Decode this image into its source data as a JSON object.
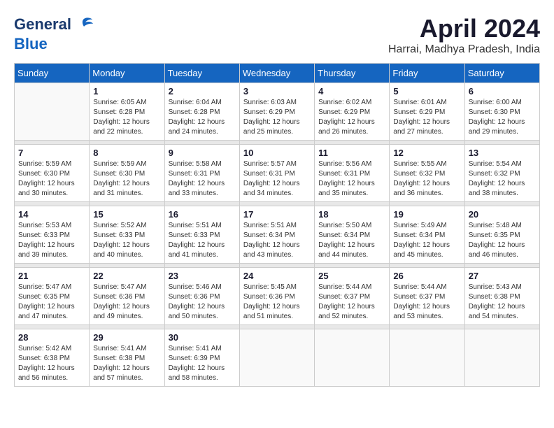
{
  "header": {
    "logo_line1": "General",
    "logo_line2": "Blue",
    "title": "April 2024",
    "subtitle": "Harrai, Madhya Pradesh, India"
  },
  "days_of_week": [
    "Sunday",
    "Monday",
    "Tuesday",
    "Wednesday",
    "Thursday",
    "Friday",
    "Saturday"
  ],
  "weeks": [
    [
      {
        "day": "",
        "info": ""
      },
      {
        "day": "1",
        "info": "Sunrise: 6:05 AM\nSunset: 6:28 PM\nDaylight: 12 hours\nand 22 minutes."
      },
      {
        "day": "2",
        "info": "Sunrise: 6:04 AM\nSunset: 6:28 PM\nDaylight: 12 hours\nand 24 minutes."
      },
      {
        "day": "3",
        "info": "Sunrise: 6:03 AM\nSunset: 6:29 PM\nDaylight: 12 hours\nand 25 minutes."
      },
      {
        "day": "4",
        "info": "Sunrise: 6:02 AM\nSunset: 6:29 PM\nDaylight: 12 hours\nand 26 minutes."
      },
      {
        "day": "5",
        "info": "Sunrise: 6:01 AM\nSunset: 6:29 PM\nDaylight: 12 hours\nand 27 minutes."
      },
      {
        "day": "6",
        "info": "Sunrise: 6:00 AM\nSunset: 6:30 PM\nDaylight: 12 hours\nand 29 minutes."
      }
    ],
    [
      {
        "day": "7",
        "info": "Sunrise: 5:59 AM\nSunset: 6:30 PM\nDaylight: 12 hours\nand 30 minutes."
      },
      {
        "day": "8",
        "info": "Sunrise: 5:59 AM\nSunset: 6:30 PM\nDaylight: 12 hours\nand 31 minutes."
      },
      {
        "day": "9",
        "info": "Sunrise: 5:58 AM\nSunset: 6:31 PM\nDaylight: 12 hours\nand 33 minutes."
      },
      {
        "day": "10",
        "info": "Sunrise: 5:57 AM\nSunset: 6:31 PM\nDaylight: 12 hours\nand 34 minutes."
      },
      {
        "day": "11",
        "info": "Sunrise: 5:56 AM\nSunset: 6:31 PM\nDaylight: 12 hours\nand 35 minutes."
      },
      {
        "day": "12",
        "info": "Sunrise: 5:55 AM\nSunset: 6:32 PM\nDaylight: 12 hours\nand 36 minutes."
      },
      {
        "day": "13",
        "info": "Sunrise: 5:54 AM\nSunset: 6:32 PM\nDaylight: 12 hours\nand 38 minutes."
      }
    ],
    [
      {
        "day": "14",
        "info": "Sunrise: 5:53 AM\nSunset: 6:33 PM\nDaylight: 12 hours\nand 39 minutes."
      },
      {
        "day": "15",
        "info": "Sunrise: 5:52 AM\nSunset: 6:33 PM\nDaylight: 12 hours\nand 40 minutes."
      },
      {
        "day": "16",
        "info": "Sunrise: 5:51 AM\nSunset: 6:33 PM\nDaylight: 12 hours\nand 41 minutes."
      },
      {
        "day": "17",
        "info": "Sunrise: 5:51 AM\nSunset: 6:34 PM\nDaylight: 12 hours\nand 43 minutes."
      },
      {
        "day": "18",
        "info": "Sunrise: 5:50 AM\nSunset: 6:34 PM\nDaylight: 12 hours\nand 44 minutes."
      },
      {
        "day": "19",
        "info": "Sunrise: 5:49 AM\nSunset: 6:34 PM\nDaylight: 12 hours\nand 45 minutes."
      },
      {
        "day": "20",
        "info": "Sunrise: 5:48 AM\nSunset: 6:35 PM\nDaylight: 12 hours\nand 46 minutes."
      }
    ],
    [
      {
        "day": "21",
        "info": "Sunrise: 5:47 AM\nSunset: 6:35 PM\nDaylight: 12 hours\nand 47 minutes."
      },
      {
        "day": "22",
        "info": "Sunrise: 5:47 AM\nSunset: 6:36 PM\nDaylight: 12 hours\nand 49 minutes."
      },
      {
        "day": "23",
        "info": "Sunrise: 5:46 AM\nSunset: 6:36 PM\nDaylight: 12 hours\nand 50 minutes."
      },
      {
        "day": "24",
        "info": "Sunrise: 5:45 AM\nSunset: 6:36 PM\nDaylight: 12 hours\nand 51 minutes."
      },
      {
        "day": "25",
        "info": "Sunrise: 5:44 AM\nSunset: 6:37 PM\nDaylight: 12 hours\nand 52 minutes."
      },
      {
        "day": "26",
        "info": "Sunrise: 5:44 AM\nSunset: 6:37 PM\nDaylight: 12 hours\nand 53 minutes."
      },
      {
        "day": "27",
        "info": "Sunrise: 5:43 AM\nSunset: 6:38 PM\nDaylight: 12 hours\nand 54 minutes."
      }
    ],
    [
      {
        "day": "28",
        "info": "Sunrise: 5:42 AM\nSunset: 6:38 PM\nDaylight: 12 hours\nand 56 minutes."
      },
      {
        "day": "29",
        "info": "Sunrise: 5:41 AM\nSunset: 6:38 PM\nDaylight: 12 hours\nand 57 minutes."
      },
      {
        "day": "30",
        "info": "Sunrise: 5:41 AM\nSunset: 6:39 PM\nDaylight: 12 hours\nand 58 minutes."
      },
      {
        "day": "",
        "info": ""
      },
      {
        "day": "",
        "info": ""
      },
      {
        "day": "",
        "info": ""
      },
      {
        "day": "",
        "info": ""
      }
    ]
  ]
}
